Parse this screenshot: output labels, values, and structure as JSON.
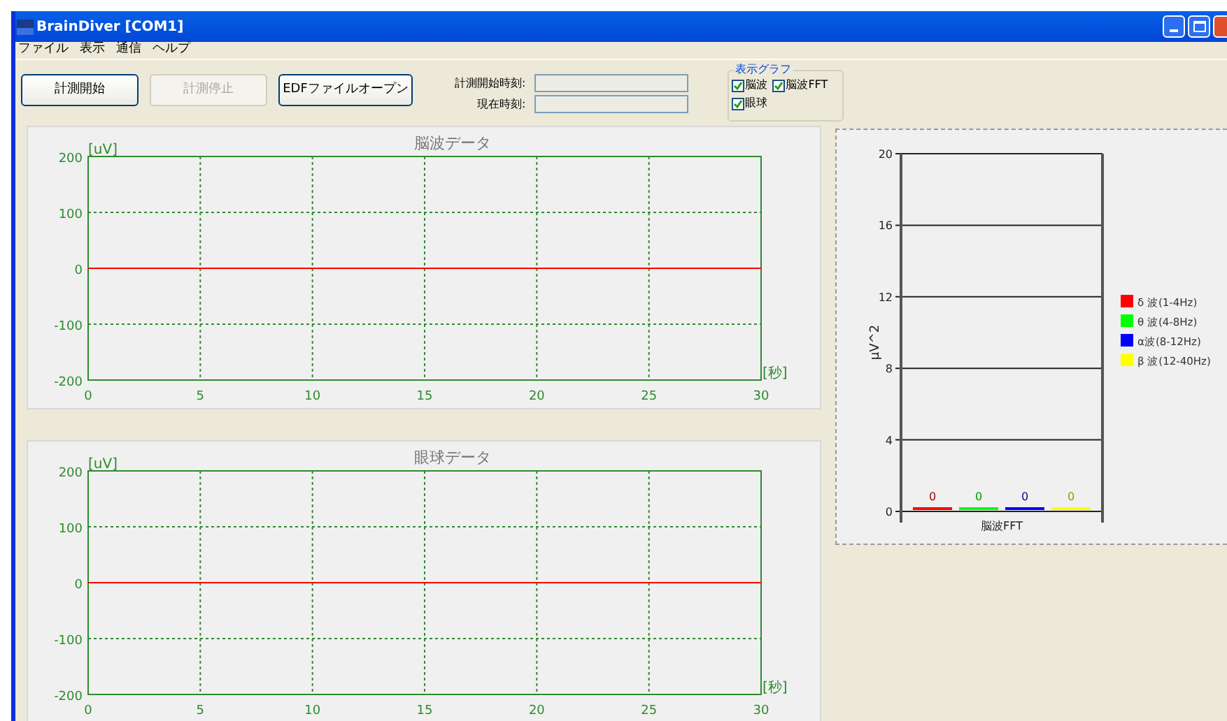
{
  "window": {
    "title": "BrainDiver [COM1]"
  },
  "menu": [
    "ファイル",
    "表示",
    "通信",
    "ヘルプ"
  ],
  "toolbar": {
    "buttons": [
      {
        "label": "計測開始",
        "disabled": false
      },
      {
        "label": "計測停止",
        "disabled": true
      },
      {
        "label": "EDFファイルオープン",
        "disabled": false
      }
    ],
    "time_fields": [
      {
        "label": "計測開始時刻:"
      },
      {
        "label": "現在時刻:"
      }
    ],
    "graph_group": {
      "title": "表示グラフ",
      "options": [
        {
          "label": "脳波",
          "checked": true
        },
        {
          "label": "脳波FFT",
          "checked": true
        },
        {
          "label": "眼球",
          "checked": true
        }
      ]
    }
  },
  "eeg_panel": {
    "chart_data": {
      "type": "line",
      "title": "脳波データ",
      "ylabel": "[uV]",
      "xlabel": "[秒]",
      "x": [
        0,
        30
      ],
      "series": [
        {
          "color": "#ff0000",
          "values": [
            0,
            0
          ]
        }
      ],
      "xlim": [
        0,
        30
      ],
      "ylim": [
        -200,
        200
      ],
      "xticks": [
        0,
        5,
        10,
        15,
        20,
        25,
        30
      ],
      "yticks": [
        -200,
        -100,
        0,
        100,
        200
      ],
      "grid": true
    }
  },
  "eog_panel": {
    "chart_data": {
      "type": "line",
      "title": "眼球データ",
      "ylabel": "[uV]",
      "xlabel": "[秒]",
      "x": [
        0,
        30
      ],
      "series": [
        {
          "color": "#ff0000",
          "values": [
            0,
            0
          ]
        }
      ],
      "xlim": [
        0,
        30
      ],
      "ylim": [
        -200,
        200
      ],
      "xticks": [
        0,
        5,
        10,
        15,
        20,
        25,
        30
      ],
      "yticks": [
        -200,
        -100,
        0,
        100,
        200
      ],
      "grid": true
    }
  },
  "fft_panel": {
    "chart_data": {
      "type": "bar",
      "ylabel": "μV^2",
      "categories": [
        "脳波FFT"
      ],
      "series": [
        {
          "name": "δ 波(1-4Hz)",
          "color": "#ff0000",
          "values": [
            0
          ]
        },
        {
          "name": "θ 波(4-8Hz)",
          "color": "#00ff00",
          "values": [
            0
          ]
        },
        {
          "name": "α波(8-12Hz)",
          "color": "#0000ff",
          "values": [
            0
          ]
        },
        {
          "name": "β 波(12-40Hz)",
          "color": "#ffff00",
          "values": [
            0
          ]
        }
      ],
      "ylim": [
        0,
        20
      ],
      "yticks": [
        0,
        4,
        8,
        12,
        16,
        20
      ],
      "grid": true,
      "legend": "right"
    },
    "readings": [
      "0",
      "0",
      "0",
      "0"
    ]
  }
}
